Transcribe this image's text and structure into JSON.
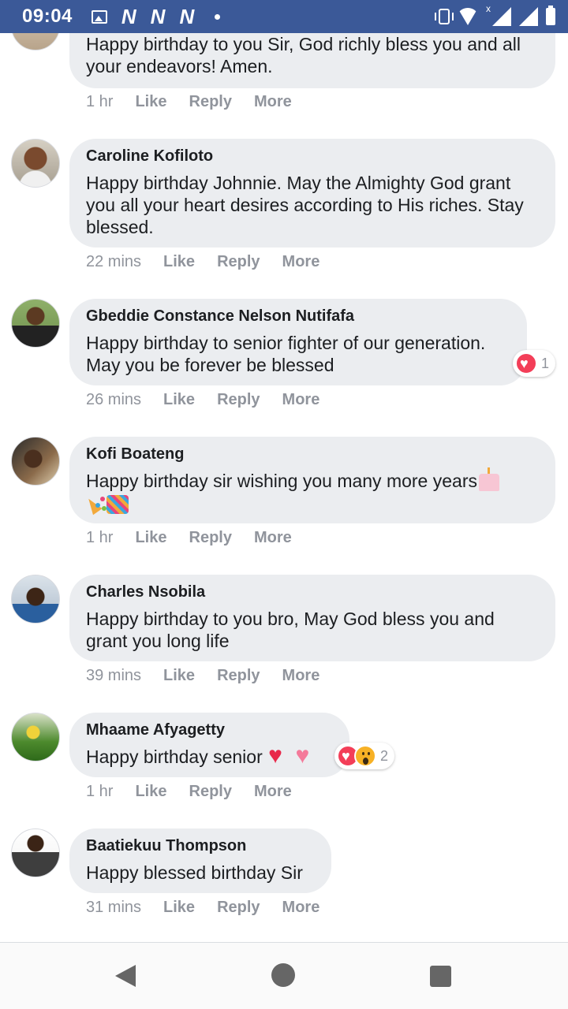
{
  "status_bar": {
    "time": "09:04",
    "network_glyphs": [
      "N",
      "N",
      "N"
    ],
    "icons": [
      "image-icon",
      "notification-dot",
      "vibrate-icon",
      "wifi-icon",
      "signal-icon",
      "signal-icon",
      "battery-icon"
    ],
    "background": "#3b5998"
  },
  "comments": [
    {
      "author": "",
      "text": "Happy birthday to you Sir, God richly bless you and all your endeavors! Amen.",
      "time": "1 hr",
      "like": "Like",
      "reply": "Reply",
      "more": "More"
    },
    {
      "author": "Caroline Kofiloto",
      "text": "Happy birthday Johnnie. May the Almighty God grant you all your heart desires according to His riches. Stay blessed.",
      "time": "22 mins",
      "like": "Like",
      "reply": "Reply",
      "more": "More"
    },
    {
      "author": "Gbeddie Constance Nelson Nutifafa",
      "text": "Happy birthday to senior fighter of our generation. May you be forever be blessed",
      "time": "26 mins",
      "like": "Like",
      "reply": "Reply",
      "more": "More",
      "reactions": {
        "icons": [
          "heart-reaction-icon"
        ],
        "count": "1"
      }
    },
    {
      "author": "Kofi Boateng",
      "text": "Happy birthday sir wishing you many more years",
      "emojis": [
        "birthday-cake-emoji",
        "party-popper-emoji",
        "confetti-emoji"
      ],
      "time": "1 hr",
      "like": "Like",
      "reply": "Reply",
      "more": "More"
    },
    {
      "author": "Charles Nsobila",
      "text": "Happy birthday to you bro, May God bless you and grant you long life",
      "time": "39 mins",
      "like": "Like",
      "reply": "Reply",
      "more": "More"
    },
    {
      "author": "Mhaame Afyagetty",
      "text": "Happy birthday senior",
      "emojis": [
        "beating-heart-emoji",
        "pink-heart-emoji"
      ],
      "time": "1 hr",
      "like": "Like",
      "reply": "Reply",
      "more": "More",
      "reactions": {
        "icons": [
          "heart-reaction-icon",
          "wow-reaction-icon"
        ],
        "count": "2"
      }
    },
    {
      "author": "Baatiekuu Thompson",
      "text": "Happy blessed birthday Sir",
      "time": "31 mins",
      "like": "Like",
      "reply": "Reply",
      "more": "More"
    }
  ],
  "navigation": {
    "buttons": [
      "back-icon",
      "home-icon",
      "recent-apps-icon"
    ]
  },
  "colors": {
    "bubble": "#ebedf0",
    "meta_text": "#90949c",
    "body_text": "#1c1e21",
    "heart": "#f33e58",
    "wow": "#f7b125"
  }
}
